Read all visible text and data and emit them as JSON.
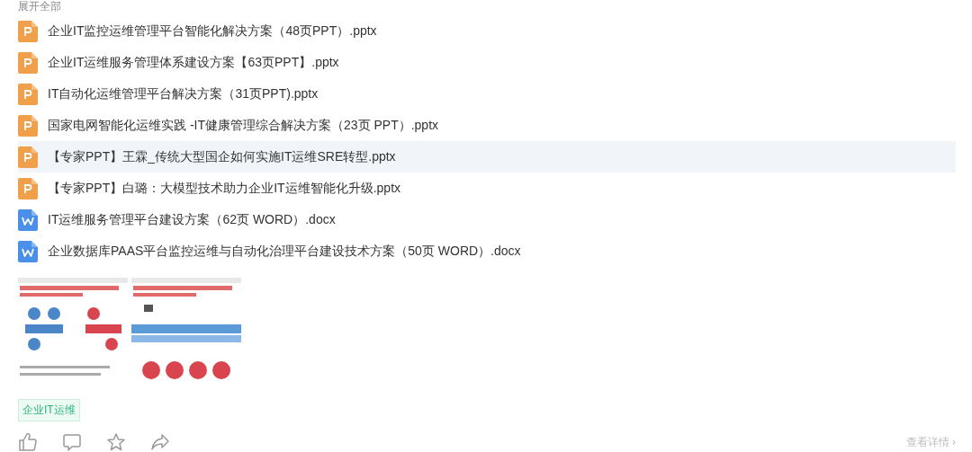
{
  "expand_link": "展开全部",
  "files": [
    {
      "name": "企业IT监控运维管理平台智能化解决方案（48页PPT）.pptx",
      "kind": "ppt",
      "hovered": false
    },
    {
      "name": "企业IT运维服务管理体系建设方案【63页PPT】.pptx",
      "kind": "ppt",
      "hovered": false
    },
    {
      "name": "IT自动化运维管理平台解决方案（31页PPT).pptx",
      "kind": "ppt",
      "hovered": false
    },
    {
      "name": "国家电网智能化运维实践 -IT健康管理综合解决方案（23页 PPT）.pptx",
      "kind": "ppt",
      "hovered": false
    },
    {
      "name": "【专家PPT】王霖_传统大型国企如何实施IT运维SRE转型.pptx",
      "kind": "ppt",
      "hovered": true
    },
    {
      "name": "【专家PPT】白璐：大模型技术助力企业IT运维智能化升级.pptx",
      "kind": "ppt",
      "hovered": false
    },
    {
      "name": "IT运维服务管理平台建设方案（62页 WORD）.docx",
      "kind": "word",
      "hovered": false
    },
    {
      "name": "企业数据库PAAS平台监控运维与自动化治理平台建设技术方案（50页 WORD）.docx",
      "kind": "word",
      "hovered": false
    }
  ],
  "images": [
    {
      "kind": "picture"
    },
    {
      "kind": "picture"
    }
  ],
  "tags": [
    "企业IT运维"
  ],
  "details_link": "查看详情 ›"
}
